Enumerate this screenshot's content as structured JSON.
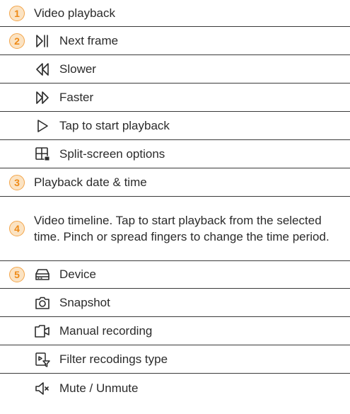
{
  "items": [
    {
      "num": "1",
      "text": "Video playback"
    },
    {
      "num": "2",
      "icon": "next-frame-icon",
      "text": "Next frame"
    },
    {
      "icon": "slower-icon",
      "text": "Slower"
    },
    {
      "icon": "faster-icon",
      "text": "Faster"
    },
    {
      "icon": "play-icon",
      "text": "Tap to start playback"
    },
    {
      "icon": "split-screen-icon",
      "text": "Split-screen options"
    },
    {
      "num": "3",
      "text": "Playback date & time"
    },
    {
      "num": "4",
      "text": "Video timeline. Tap to start playback from the selected time. Pinch or spread fingers to change the time period."
    },
    {
      "num": "5",
      "icon": "device-icon",
      "text": "Device"
    },
    {
      "icon": "camera-icon",
      "text": "Snapshot"
    },
    {
      "icon": "video-camera-icon",
      "text": "Manual recording"
    },
    {
      "icon": "filter-recordings-icon",
      "text": "Filter recodings type"
    },
    {
      "icon": "speaker-mute-icon",
      "text": "Mute / Unmute"
    }
  ],
  "colors": {
    "badge_fill": "#fbe3c3",
    "badge_stroke": "#f3a54a",
    "badge_text": "#ee8a17",
    "text": "#2b2b2b",
    "divider": "#3a3a3a"
  }
}
